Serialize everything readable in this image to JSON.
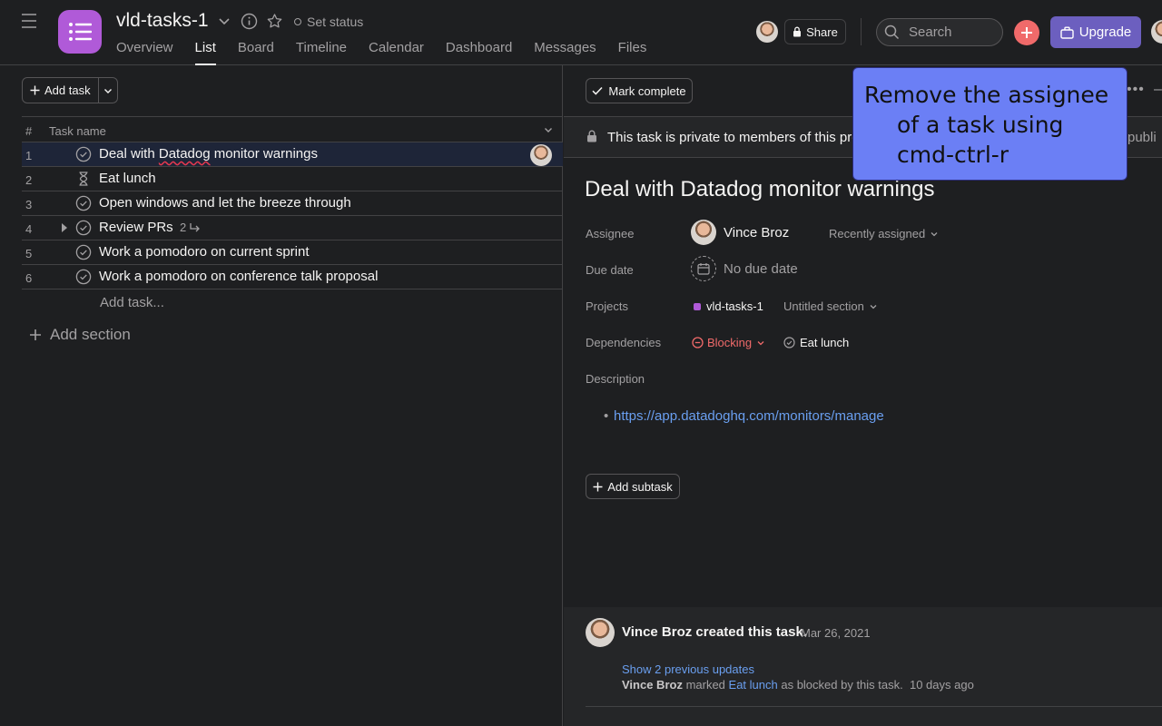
{
  "project": {
    "title": "vld-tasks-1",
    "set_status": "Set status",
    "color": "#b05ad8"
  },
  "tabs": [
    "Overview",
    "List",
    "Board",
    "Timeline",
    "Calendar",
    "Dashboard",
    "Messages",
    "Files"
  ],
  "active_tab": "List",
  "header": {
    "share_label": "Share",
    "search_placeholder": "Search",
    "upgrade_label": "Upgrade"
  },
  "list": {
    "add_task_label": "Add task",
    "col_hash": "#",
    "col_name": "Task name",
    "rows": [
      {
        "num": "1",
        "name_part1": "Deal with ",
        "name_flagged": "Datadog",
        "name_part2": " monitor warnings",
        "status_icon": "check-circle-icon"
      },
      {
        "num": "2",
        "name": "Eat lunch",
        "status_icon": "hourglass-icon"
      },
      {
        "num": "3",
        "name": "Open windows and let the breeze through",
        "status_icon": "check-circle-icon"
      },
      {
        "num": "4",
        "name": "Review PRs",
        "subtasks": "2",
        "status_icon": "check-circle-icon"
      },
      {
        "num": "5",
        "name": "Work a pomodoro on current sprint",
        "status_icon": "check-circle-icon"
      },
      {
        "num": "6",
        "name": "Work a pomodoro on conference talk proposal",
        "status_icon": "check-circle-icon"
      }
    ],
    "add_task_inline": "Add task...",
    "add_section": "Add section"
  },
  "detail": {
    "mark_complete": "Mark complete",
    "private_notice": "This task is private to members of this pro",
    "private_notice_tail": "publi",
    "title": "Deal with Datadog monitor warnings",
    "labels": {
      "assignee": "Assignee",
      "due_date": "Due date",
      "projects": "Projects",
      "dependencies": "Dependencies",
      "description": "Description"
    },
    "assignee_name": "Vince Broz",
    "recently_assigned": "Recently assigned",
    "due_value": "No due date",
    "project_name": "vld-tasks-1",
    "section_name": "Untitled section",
    "blocking_label": "Blocking",
    "blocked_task": "Eat lunch",
    "description_link": "https://app.datadoghq.com/monitors/manage",
    "add_subtask": "Add subtask"
  },
  "activity": {
    "created_text": "Vince Broz created this task.",
    "created_date": "Mar 26, 2021",
    "show_previous": "Show 2 previous updates",
    "actor": "Vince Broz",
    "verb": " marked ",
    "linked_task": "Eat lunch",
    "rest": " as blocked by this task.",
    "when": "10 days ago"
  },
  "callout": {
    "line1": "Remove the assignee",
    "line2": "of a task using",
    "line3": "cmd-ctrl-r"
  }
}
